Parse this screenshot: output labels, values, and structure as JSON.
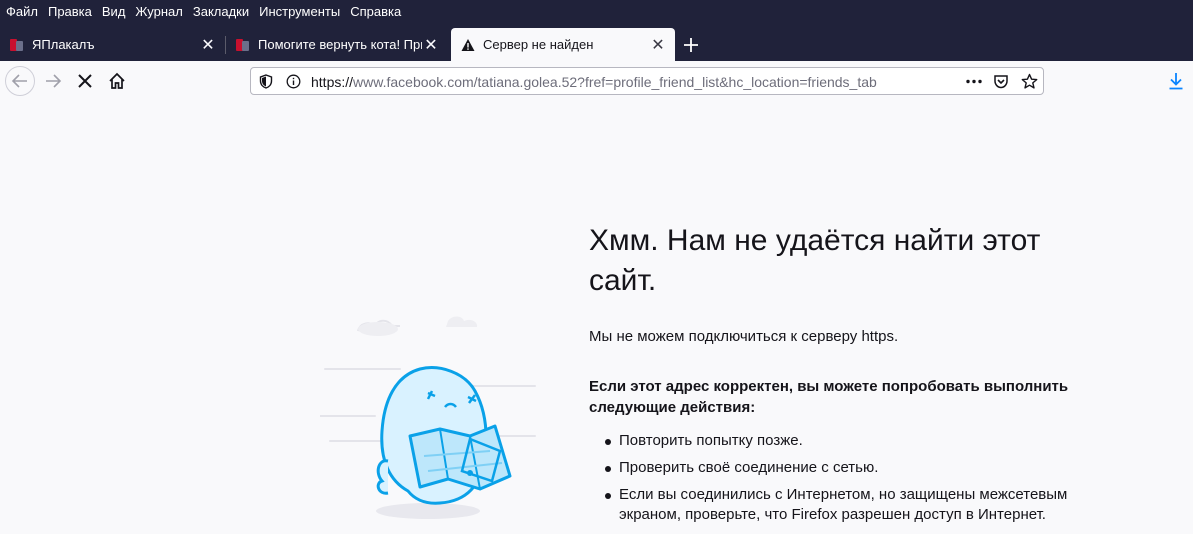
{
  "menu": {
    "file": "Файл",
    "edit": "Правка",
    "view": "Вид",
    "history": "Журнал",
    "bookmarks": "Закладки",
    "tools": "Инструменты",
    "help": "Справка"
  },
  "tabs": [
    {
      "title": "ЯПлакалъ",
      "active": false
    },
    {
      "title": "Помогите вернуть кота! Прик",
      "active": false
    },
    {
      "title": "Сервер не найден",
      "active": true
    }
  ],
  "url": {
    "scheme": "https://",
    "rest": "www.facebook.com/tatiana.golea.52?fref=profile_friend_list&hc_location=friends_tab"
  },
  "error": {
    "title": "Хмм. Нам не удаётся найти этот сайт.",
    "description": "Мы не можем подключиться к серверу https.",
    "subtitle": "Если этот адрес корректен, вы можете попробовать выполнить следующие действия:",
    "suggestions": [
      "Повторить попытку позже.",
      "Проверить своё соединение с сетью.",
      "Если вы соединились с Интернетом, но защищены межсетевым экраном, проверьте, что Firefox разрешен доступ в Интернет."
    ]
  },
  "colors": {
    "chrome": "#20223a",
    "page_bg": "#f9f9fb",
    "accent_blue": "#0a84ff"
  }
}
